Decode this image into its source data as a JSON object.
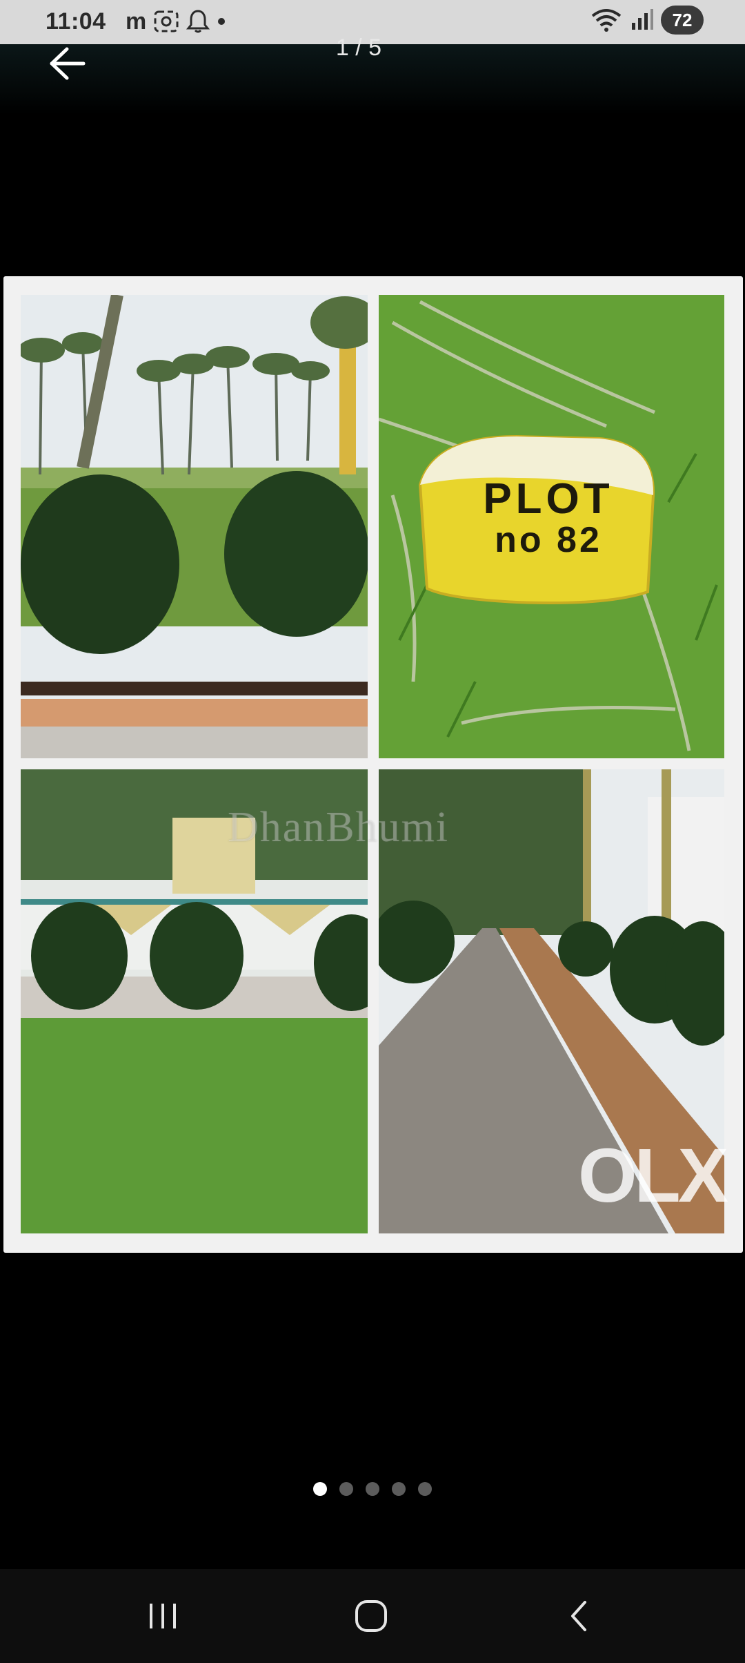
{
  "status_bar": {
    "time": "11:04",
    "carrier_badge": "m",
    "battery": "72",
    "icons": [
      "screenshot-icon",
      "bell-icon",
      "dot-icon",
      "wifi-icon",
      "signal-icon",
      "battery-icon"
    ]
  },
  "app_bar": {
    "page_counter": "1 / 5",
    "back_icon": "arrow-left-icon"
  },
  "viewer": {
    "watermark": "DhanBhumi",
    "brand_logo": "OLX",
    "plot_marker_text_line1": "PLOT",
    "plot_marker_text_line2": "no 82"
  },
  "pagination": {
    "total": 5,
    "active_index": 0
  },
  "nav_bar": {
    "icons": [
      "recents-icon",
      "home-icon",
      "back-nav-icon"
    ]
  },
  "colors": {
    "background": "#000000",
    "status_bar": "#d9d9d9",
    "collage_border": "#f1f1f1",
    "grass": "#5c9a3a",
    "marker_yellow": "#e8d52c"
  }
}
